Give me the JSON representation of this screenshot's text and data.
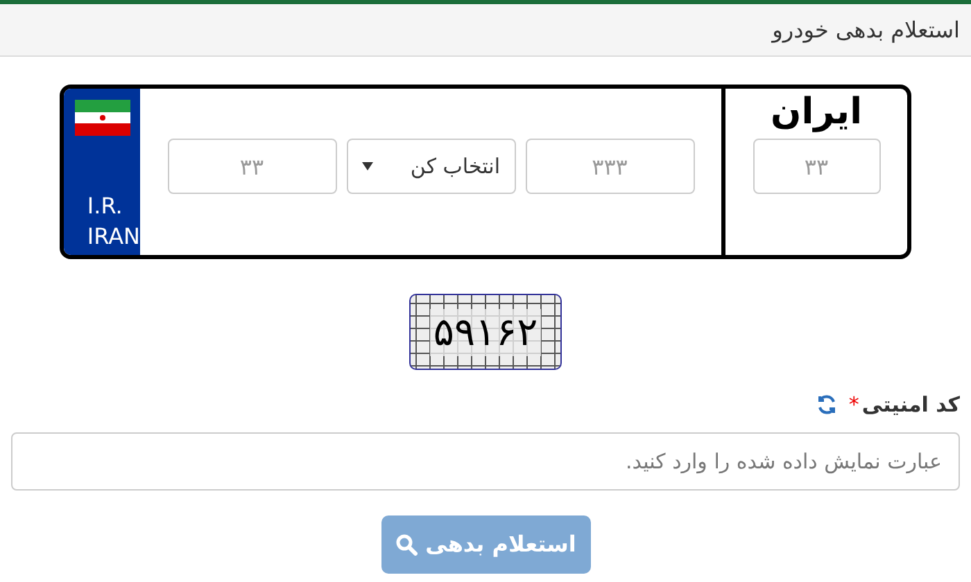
{
  "header": {
    "title": "استعلام بدهی خودرو"
  },
  "plate": {
    "country_code": "I.R.",
    "country_name": "IRAN",
    "region_label": "ایران",
    "fields": [
      {
        "kind": "input",
        "placeholder": "۳۳۳"
      },
      {
        "kind": "select",
        "value": "انتخاب کن"
      },
      {
        "kind": "input",
        "placeholder": "۳۳"
      }
    ],
    "region_field": {
      "placeholder": "۳۳"
    }
  },
  "captcha": {
    "text": "۵۹۱۶۲"
  },
  "security": {
    "label": "کد امنیتی",
    "required_mark": "*",
    "placeholder": "عبارت نمایش داده شده را وارد کنید."
  },
  "submit": {
    "label": "استعلام بدهی",
    "disabled": true
  }
}
